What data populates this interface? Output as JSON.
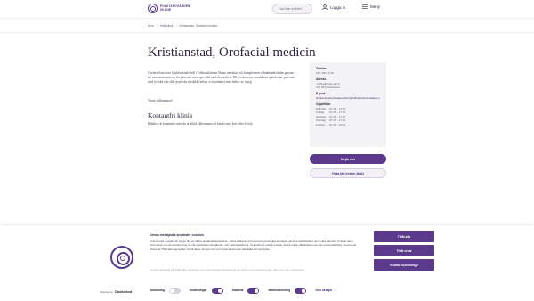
{
  "header": {
    "logo_text": "FOLKTANDVÅRDEN SKÅNE",
    "search_placeholder": "Vad letar du efter?",
    "login_label": "Logga in",
    "menu_label": "Meny"
  },
  "breadcrumb": [
    "Hem",
    "Hitta klinik",
    "Kristianstad, Orofacial medicin"
  ],
  "page": {
    "title": "Kristianstad, Orofacial medicin",
    "intro": "Orofacial medicin (sjukhustandvård) i Folktandvården Skåne omfattar och kompletterar allmäntandvården genom att vara remissinstans för patienter med speciella tandvårdsbehov. Till oss kommer munhålans sjukdomar, patienter med fysiska och eller psykiska särskilda behov och patienter med behov av intyg.",
    "welcome": "Varmt välkommen!",
    "section_title": "Kontantfri klinik",
    "walkin": "Kliniken är kontantfri men du är alltid välkommen att betala med kort eller Swish."
  },
  "card": {
    "phone_label": "Telefon",
    "phone": "044-309 16 00",
    "address_label": "Adress",
    "address_line1": "J A Hedlunds väg 5",
    "address_line2": "291 85 Kristianstad",
    "email_label": "E-post",
    "email": "kristianstadorofacialmedicin@folktandvardenskane.se",
    "hours_label": "Öppettider",
    "hours": [
      {
        "day": "Måndag",
        "time": "07:15 - 17:00"
      },
      {
        "day": "Tisdag",
        "time": "07:15 - 17:00"
      },
      {
        "day": "Onsdag",
        "time": "07:15 - 17:00"
      },
      {
        "day": "Torsdag",
        "time": "07:15 - 17:00"
      },
      {
        "day": "Fredag",
        "time": "07:15 - 15:00"
      }
    ]
  },
  "buttons": {
    "contact": "Mejla oss",
    "referral": "Hitta hit (extern länk)"
  },
  "cookie": {
    "title": "Denna webbplats använder cookies",
    "text": "Vi använder cookies för att ge dig en bättre användarupplevelse, utföra analyser och leverera personligt anpassat på våra webbplatser och i våra tjänster. Vi delar även information om din användning av vår webbplats och tjänster och marknadsföring. Vi använder också cookies för att mäta effektiviteten av vår marknadsföring. Genom att klicka på 'Tillåt alla' samtycker du till detta. Du kan när som helst ändra eller återkalla ditt samtycke.",
    "text2": "Genom att klicka på 'Tillåt alla' samtycker du till att cookies används för de syften som beskrivs ovan. Läs mer i vår cookiepolicy.",
    "allow_all": "Tillåt alla",
    "allow_selection": "Tillåt urval",
    "deny": "Endast nödvändiga",
    "toggles": [
      {
        "label": "Nödvändig",
        "on": false
      },
      {
        "label": "Inställningar",
        "on": true
      },
      {
        "label": "Statistik",
        "on": true
      },
      {
        "label": "Marknadsföring",
        "on": true
      }
    ],
    "details_label": "Visa detaljer",
    "powered_by": "Powered by",
    "brand": "Cookiebot"
  }
}
